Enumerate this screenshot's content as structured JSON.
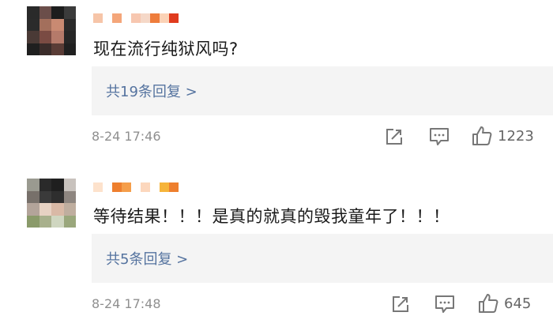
{
  "comments": [
    {
      "text": "现在流行纯狱风吗?",
      "replies_label": "共19条回复 >",
      "timestamp": "8-24 17:46",
      "likes": "1223",
      "avatar_colors": [
        "#2a2a2a",
        "#6b4e4a",
        "#1d1d1d",
        "#3b3b3b",
        "#2b2b2b",
        "#a36f5c",
        "#c98a72",
        "#2a2a2a",
        "#4a3a36",
        "#7a4b43",
        "#b57a6a",
        "#262626",
        "#1f1f1f",
        "#3a2c2a",
        "#5a3c36",
        "#202020"
      ],
      "name_colors": [
        "#f6c5a8",
        "#ffffff",
        "#f4a67a",
        "#ffffff",
        "#f7c7b0",
        "#f5d8c8",
        "#ee7d3c",
        "#fbd2b6",
        "#e03b1e"
      ]
    },
    {
      "text": "等待结果！！！是真的就真的毁我童年了！！！",
      "replies_label": "共5条回复 >",
      "timestamp": "8-24 17:48",
      "likes": "645",
      "avatar_colors": [
        "#9a9a90",
        "#2a2a2a",
        "#1f1f1f",
        "#c8c2bd",
        "#77706a",
        "#3a3a3a",
        "#2e2e2e",
        "#8e8680",
        "#b3a49a",
        "#e7d2c3",
        "#d9b9a6",
        "#bfae9f",
        "#8a9a6a",
        "#a8b08c",
        "#cfd6c0",
        "#9aa77c"
      ],
      "name_colors": [
        "#fde2cc",
        "#ffffff",
        "#ee7f2e",
        "#f59e4a",
        "#ffffff",
        "#fcd7bd",
        "#ffffff",
        "#f6b43a",
        "#ee7f2e"
      ]
    }
  ]
}
